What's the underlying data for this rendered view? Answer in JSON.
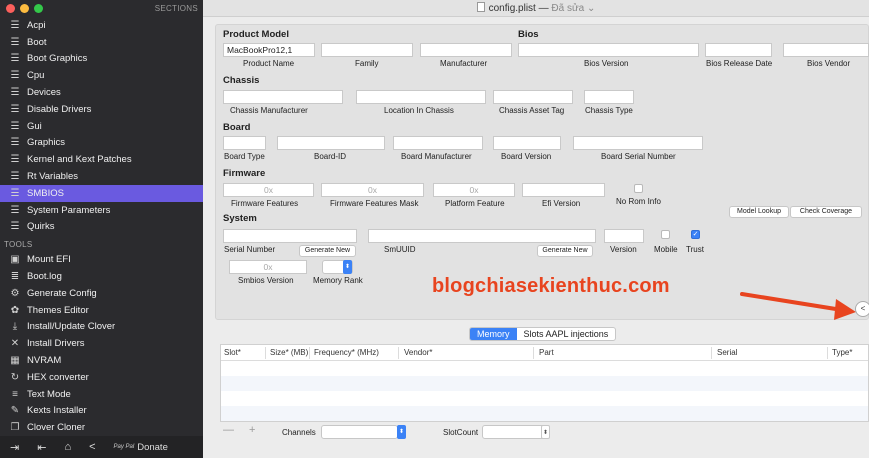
{
  "sidebar": {
    "sections_label": "SECTIONS",
    "items": [
      {
        "label": "Acpi"
      },
      {
        "label": "Boot"
      },
      {
        "label": "Boot Graphics"
      },
      {
        "label": "Cpu"
      },
      {
        "label": "Devices"
      },
      {
        "label": "Disable Drivers"
      },
      {
        "label": "Gui"
      },
      {
        "label": "Graphics"
      },
      {
        "label": "Kernel and Kext Patches"
      },
      {
        "label": "Rt Variables"
      },
      {
        "label": "SMBIOS",
        "active": true
      },
      {
        "label": "System Parameters"
      },
      {
        "label": "Quirks"
      }
    ],
    "tools_label": "TOOLS",
    "tools": [
      {
        "label": "Mount EFI",
        "icon": "drive-icon"
      },
      {
        "label": "Boot.log",
        "icon": "log-icon"
      },
      {
        "label": "Generate Config",
        "icon": "config-icon"
      },
      {
        "label": "Themes Editor",
        "icon": "palette-icon"
      },
      {
        "label": "Install/Update Clover",
        "icon": "download-icon"
      },
      {
        "label": "Install Drivers",
        "icon": "tools-icon"
      },
      {
        "label": "NVRAM",
        "icon": "chip-icon"
      },
      {
        "label": "HEX converter",
        "icon": "refresh-icon"
      },
      {
        "label": "Text Mode",
        "icon": "text-icon"
      },
      {
        "label": "Kexts Installer",
        "icon": "kext-icon"
      },
      {
        "label": "Clover Cloner",
        "icon": "clone-icon"
      }
    ],
    "donate_label": "Donate",
    "donate_pay": "Pay Pal",
    "active_color": "#6a5ae0"
  },
  "titlebar": {
    "filename": "config.plist",
    "separator": "—",
    "status": "Đã sửa"
  },
  "product_model": {
    "heading": "Product Model",
    "product_name_value": "MacBookPro12,1",
    "labels": {
      "product_name": "Product Name",
      "family": "Family",
      "manufacturer": "Manufacturer"
    }
  },
  "bios": {
    "heading": "Bios",
    "labels": {
      "version": "Bios Version",
      "release_date": "Bios Release Date",
      "vendor": "Bios Vendor"
    }
  },
  "chassis": {
    "heading": "Chassis",
    "labels": {
      "manufacturer": "Chassis Manufacturer",
      "location": "Location In Chassis",
      "asset_tag": "Chassis  Asset Tag",
      "type": "Chassis Type"
    }
  },
  "board": {
    "heading": "Board",
    "labels": {
      "type": "Board Type",
      "id": "Board-ID",
      "manufacturer": "Board Manufacturer",
      "version": "Board Version",
      "serial": "Board Serial Number"
    }
  },
  "firmware": {
    "heading": "Firmware",
    "placeholder": "0x",
    "labels": {
      "features": "Firmware Features",
      "mask": "Firmware Features Mask",
      "platform": "Platform Feature",
      "efi": "Efi Version",
      "no_rom": "No Rom Info"
    }
  },
  "buttons": {
    "model_lookup": "Model Lookup",
    "check_coverage": "Check Coverage"
  },
  "system": {
    "heading": "System",
    "labels": {
      "serial": "Serial Number",
      "smuuid": "SmUUID",
      "version": "Version",
      "mobile": "Mobile",
      "trust": "Trust",
      "smbios_version": "Smbios Version",
      "memory_rank": "Memory Rank"
    },
    "generate_new": "Generate New",
    "smbios_version_placeholder": "0x",
    "mobile_checked": false,
    "trust_checked": true
  },
  "watermark": "blogchiasekienthuc.com",
  "memory": {
    "tabs": [
      "Memory",
      "Slots AAPL injections"
    ],
    "selected_tab": "Memory",
    "columns": [
      "Slot*",
      "Size* (MB)",
      "Frequency* (MHz)",
      "Vendor*",
      "Part",
      "Serial",
      "Type*"
    ],
    "footer": {
      "plus_minus": "— +",
      "channels": "Channels",
      "slotcount": "SlotCount"
    }
  },
  "colors": {
    "accent": "#3b82f6",
    "arrow": "#e8441f"
  }
}
